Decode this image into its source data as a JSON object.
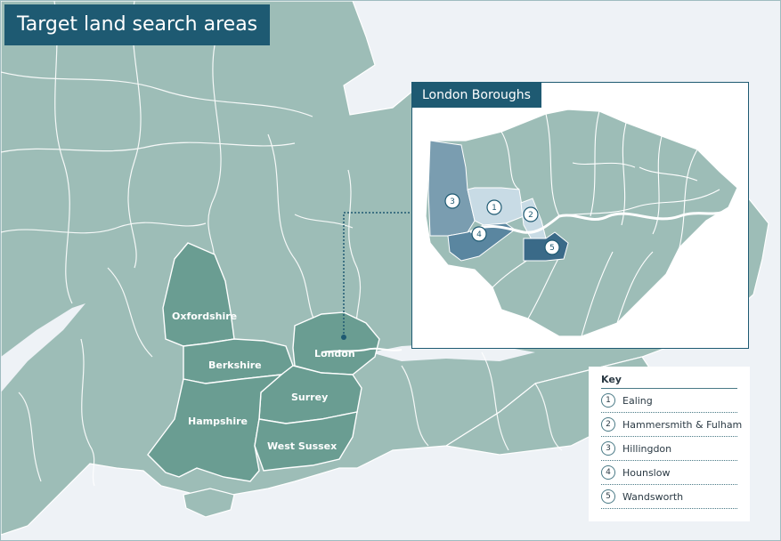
{
  "title": "Target land search areas",
  "colors": {
    "sea": "#eef2f6",
    "land": "#9dbdb7",
    "border": "#ffffff",
    "target_area": "#6a9d92",
    "title_bg": "#1e5a72",
    "inset_bg": "#ffffff",
    "borough_hillingdon": "#7a9db0",
    "borough_ealing": "#c8dbe5",
    "borough_hammersmith": "#c8dbe5",
    "borough_hounslow": "#5a86a0",
    "borough_wandsworth": "#3a6a88"
  },
  "counties": {
    "oxfordshire": "Oxfordshire",
    "berkshire": "Berkshire",
    "hampshire": "Hampshire",
    "surrey": "Surrey",
    "west_sussex": "West Sussex",
    "london": "London"
  },
  "inset": {
    "title": "London Boroughs",
    "markers": [
      "1",
      "2",
      "3",
      "4",
      "5"
    ]
  },
  "key": {
    "title": "Key",
    "items": [
      {
        "num": "1",
        "label": "Ealing"
      },
      {
        "num": "2",
        "label": "Hammersmith & Fulham"
      },
      {
        "num": "3",
        "label": "Hillingdon"
      },
      {
        "num": "4",
        "label": "Hounslow"
      },
      {
        "num": "5",
        "label": "Wandsworth"
      }
    ]
  }
}
